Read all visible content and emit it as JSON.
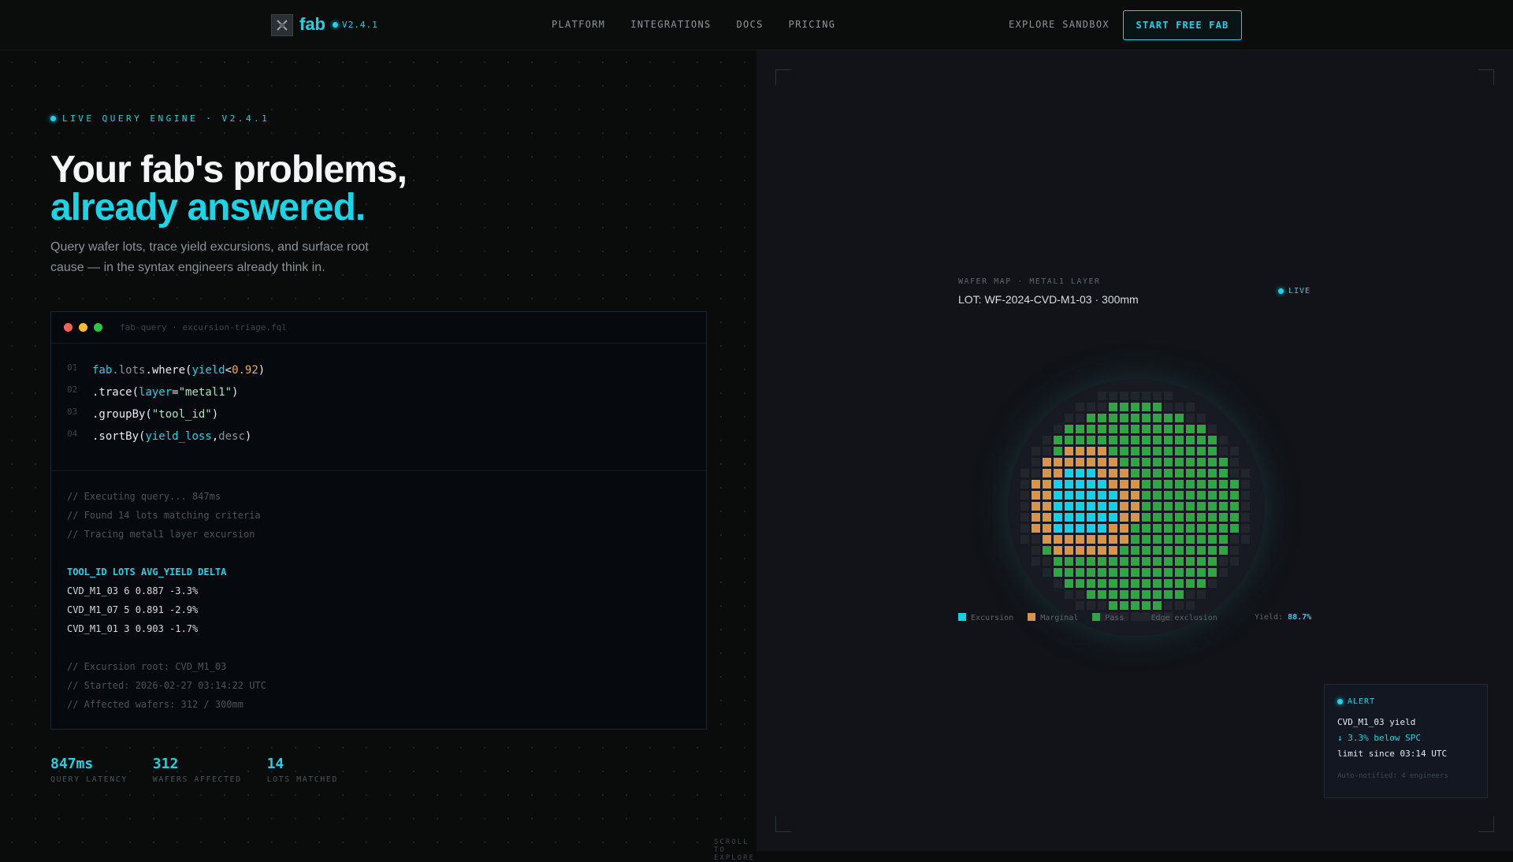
{
  "nav": {
    "logo": "fab",
    "version": "V2.4.1",
    "links": [
      "PLATFORM",
      "INTEGRATIONS",
      "DOCS",
      "PRICING"
    ],
    "explore": "EXPLORE SANDBOX",
    "cta": "START FREE FAB"
  },
  "hero": {
    "eyebrow": "LIVE QUERY ENGINE · V2.4.1",
    "title_line1": "Your fab's problems,",
    "title_line2": "already answered.",
    "subtitle": "Query wafer lots, trace yield excursions, and surface root cause — in the syntax engineers already think in."
  },
  "editor": {
    "filename": "fab-query · excursion-triage.fql",
    "line_numbers": [
      "01",
      "02",
      "03",
      "04"
    ],
    "code": {
      "l1": {
        "a": "fab",
        "b": ".lots",
        "c": ".where(",
        "d": "yield",
        "e": "<",
        "f": "0.92",
        "g": ")"
      },
      "l2": {
        "a": ".trace(",
        "b": "layer",
        "c": "=",
        "d": "\"metal1\"",
        "e": ")"
      },
      "l3": {
        "a": ".groupBy(",
        "b": "\"tool_id\"",
        "c": ")"
      },
      "l4": {
        "a": ".sortBy(",
        "b": "yield_loss",
        "c": ",",
        "d": " desc",
        "e": ")"
      }
    },
    "output": {
      "comments1": [
        "// Executing query... 847ms",
        "// Found 14 lots matching criteria",
        "// Tracing metal1 layer excursion"
      ],
      "header": "TOOL_ID LOTS AVG_YIELD DELTA",
      "rows": [
        "CVD_M1_03 6 0.887 -3.3%",
        "CVD_M1_07 5 0.891 -2.9%",
        "CVD_M1_01 3 0.903 -1.7%"
      ],
      "comments2": [
        "// Excursion root: CVD_M1_03",
        "// Started: 2026-02-27 03:14:22 UTC",
        "// Affected wafers: 312 / 300mm"
      ]
    }
  },
  "stats": [
    {
      "value": "847ms",
      "label": "QUERY LATENCY"
    },
    {
      "value": "312",
      "label": "WAFERS AFFECTED"
    },
    {
      "value": "14",
      "label": "LOTS MATCHED"
    }
  ],
  "scroll_hint": "SCROLL TO EXPLORE",
  "wafer": {
    "caption": "WAFER MAP · METAL1 LAYER",
    "lot": "LOT: WF-2024-CVD-M1-03 · 300mm",
    "live": "LIVE",
    "legend": [
      "Excursion",
      "Marginal",
      "Pass",
      "Edge exclusion"
    ],
    "yield_label": "Yield:",
    "yield_value": "88.7%",
    "colors": {
      "excursion": "#12d2ea",
      "marginal": "#d99448",
      "pass": "#2ea642",
      "edge": "#22252c"
    }
  },
  "alert": {
    "title": "ALERT",
    "line1": "CVD_M1_03 yield",
    "line2": "↓ 3.3% below SPC",
    "line3": "limit since 03:14 UTC",
    "footer": "Auto-notified: 4 engineers"
  }
}
